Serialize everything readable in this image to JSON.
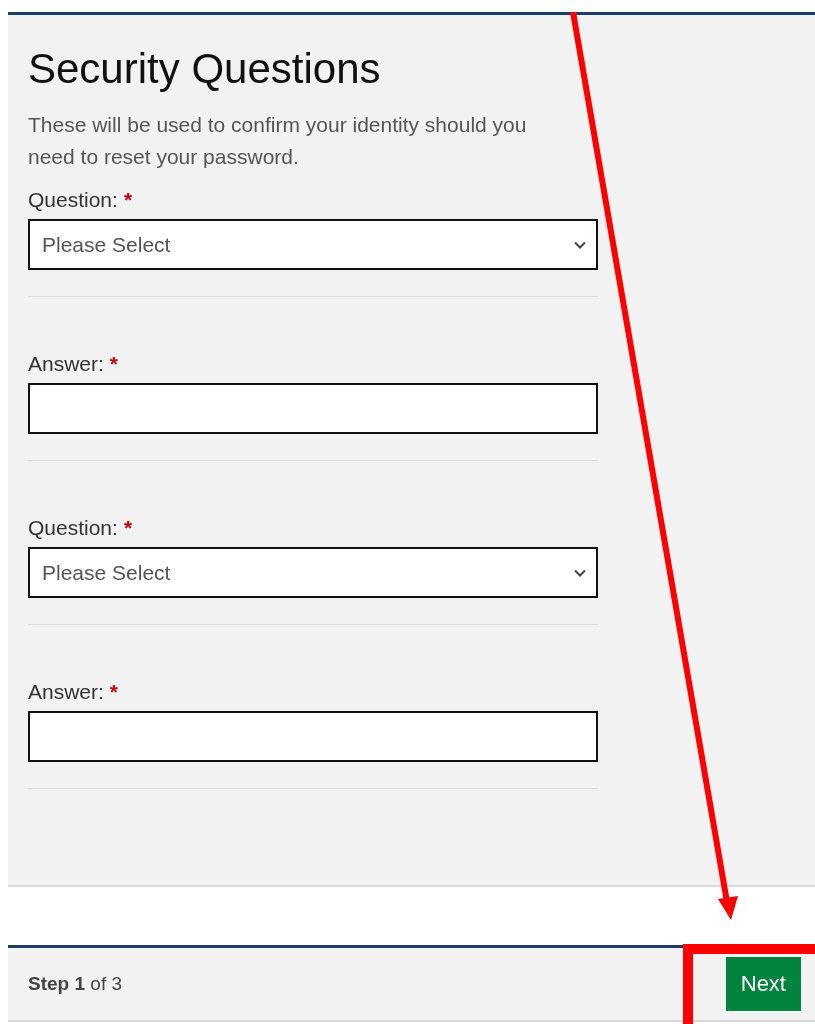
{
  "form": {
    "title": "Security Questions",
    "intro": "These will be used to confirm your identity should you need to reset your password.",
    "fields": [
      {
        "kind": "select",
        "label": "Question:",
        "required_mark": "*",
        "value": "Please Select"
      },
      {
        "kind": "text",
        "label": "Answer:",
        "required_mark": "*"
      },
      {
        "kind": "select",
        "label": "Question:",
        "required_mark": "*",
        "value": "Please Select"
      },
      {
        "kind": "text",
        "label": "Answer:",
        "required_mark": "*"
      }
    ]
  },
  "footer": {
    "step": "**Step 1** of 3",
    "button": "Next"
  },
  "annotation": {
    "kind": "arrow_and_box"
  }
}
